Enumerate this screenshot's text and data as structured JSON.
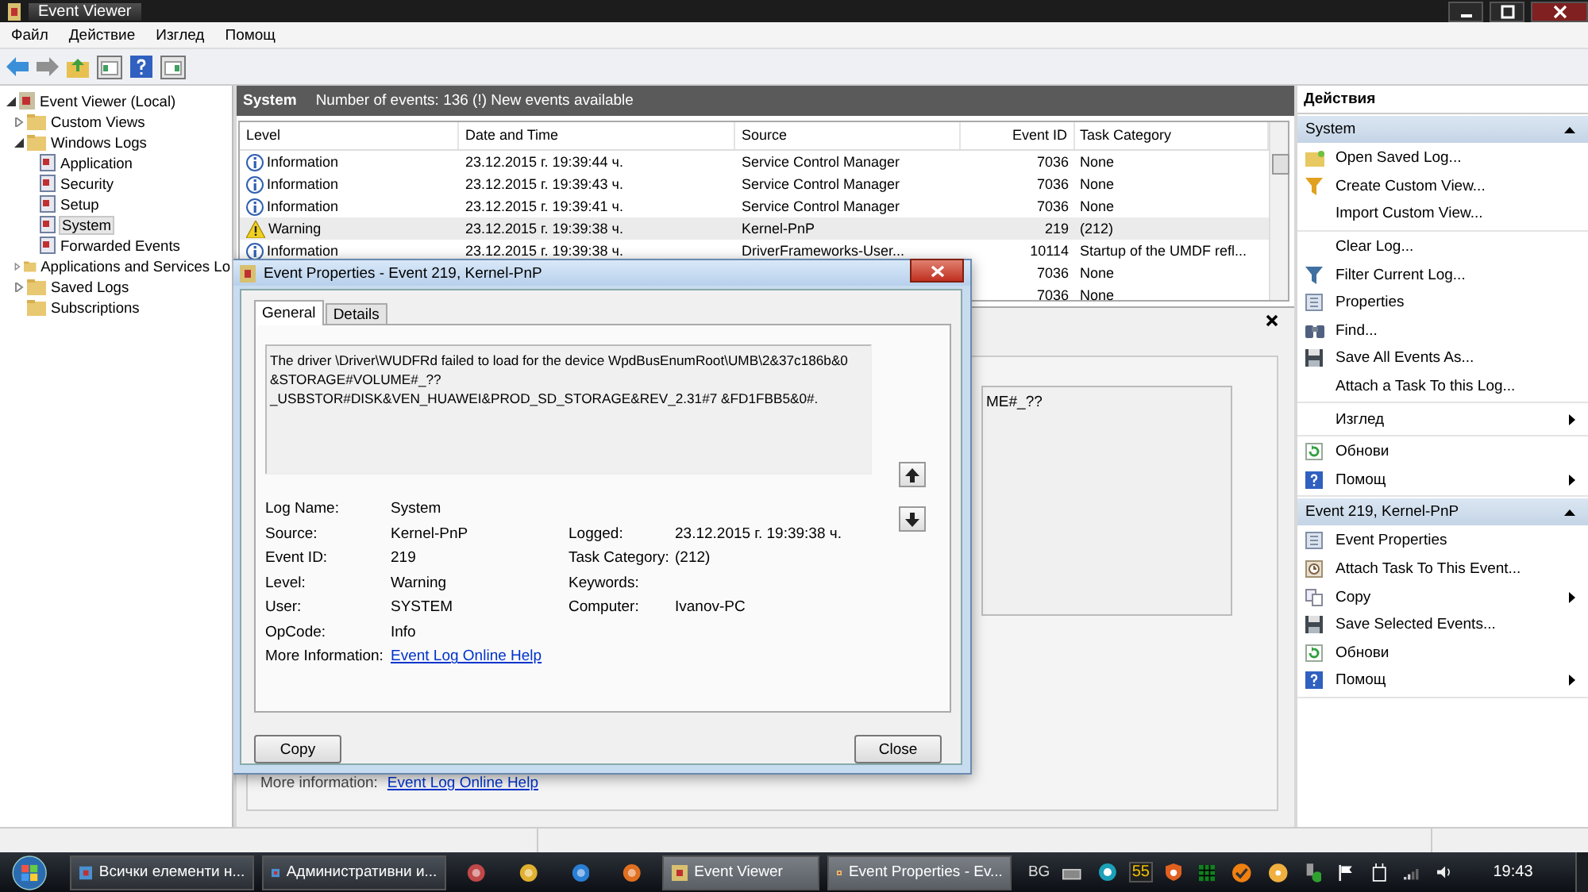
{
  "window": {
    "title": "Event Viewer"
  },
  "menu": [
    "Файл",
    "Действие",
    "Изглед",
    "Помощ"
  ],
  "tree": [
    {
      "label": "Event Viewer (Local)",
      "selected": false,
      "expanded": true,
      "children": [
        {
          "label": "Custom Views",
          "selected": false,
          "expanded": false
        },
        {
          "label": "Windows Logs",
          "selected": false,
          "expanded": true,
          "children": [
            {
              "label": "Application",
              "selected": false
            },
            {
              "label": "Security",
              "selected": false
            },
            {
              "label": "Setup",
              "selected": false
            },
            {
              "label": "System",
              "selected": true
            },
            {
              "label": "Forwarded Events",
              "selected": false
            }
          ]
        },
        {
          "label": "Applications and Services Lo",
          "selected": false,
          "expanded": false
        },
        {
          "label": "Saved Logs",
          "selected": false,
          "expanded": false
        },
        {
          "label": "Subscriptions",
          "selected": false
        }
      ]
    }
  ],
  "log_header": {
    "name": "System",
    "summary": "Number of events: 136 (!) New events available"
  },
  "table": {
    "columns": [
      "Level",
      "Date and Time",
      "Source",
      "Event ID",
      "Task Category"
    ],
    "rows": [
      {
        "kind": "info",
        "level": "Information",
        "date": "23.12.2015 г. 19:39:44 ч.",
        "source": "Service Control Manager",
        "event_id": "7036",
        "task_category": "None",
        "selected": false
      },
      {
        "kind": "info",
        "level": "Information",
        "date": "23.12.2015 г. 19:39:43 ч.",
        "source": "Service Control Manager",
        "event_id": "7036",
        "task_category": "None",
        "selected": false
      },
      {
        "kind": "info",
        "level": "Information",
        "date": "23.12.2015 г. 19:39:41 ч.",
        "source": "Service Control Manager",
        "event_id": "7036",
        "task_category": "None",
        "selected": false
      },
      {
        "kind": "warning",
        "level": "Warning",
        "date": "23.12.2015 г. 19:39:38 ч.",
        "source": "Kernel-PnP",
        "event_id": "219",
        "task_category": "(212)",
        "selected": true
      },
      {
        "kind": "info",
        "level": "Information",
        "date": "23.12.2015 г. 19:39:38 ч.",
        "source": "DriverFrameworks-User...",
        "event_id": "10114",
        "task_category": "Startup of the UMDF refl...",
        "selected": false
      },
      {
        "kind": "hidden",
        "event_id": "7036",
        "task_category": "None",
        "selected": false
      },
      {
        "kind": "hidden",
        "event_id": "7036",
        "task_category": "None",
        "selected": false
      }
    ]
  },
  "preview": {
    "message_fragment": "ME#_??",
    "more_info_label": "More information:",
    "more_info_link": "Event Log Online Help"
  },
  "dialog": {
    "title": "Event Properties - Event 219, Kernel-PnP",
    "tabs": [
      {
        "label": "General",
        "selected": true
      },
      {
        "label": "Details",
        "selected": false
      }
    ],
    "message": "The driver \\Driver\\WUDFRd failed to load for the device WpdBusEnumRoot\\UMB\\2&37c186b&0 &STORAGE#VOLUME#_??_USBSTOR#DISK&VEN_HUAWEI&PROD_SD_STORAGE&REV_2.31#7 &FD1FBB5&0#.",
    "fields_left": [
      {
        "label": "Log Name:",
        "value": "System"
      },
      {
        "label": "Source:",
        "value": "Kernel-PnP"
      },
      {
        "label": "Event ID:",
        "value": "219"
      },
      {
        "label": "Level:",
        "value": "Warning"
      },
      {
        "label": "User:",
        "value": "SYSTEM"
      },
      {
        "label": "OpCode:",
        "value": "Info"
      }
    ],
    "fields_right": [
      {
        "label": "Logged:",
        "value": "23.12.2015 г. 19:39:38 ч."
      },
      {
        "label": "Task Category:",
        "value": "(212)"
      },
      {
        "label": "Keywords:"
      },
      {
        "label": "Computer:",
        "value": "Ivanov-PC"
      }
    ],
    "more_info_label": "More Information:",
    "more_info_link": "Event Log Online Help",
    "buttons": [
      "Copy",
      "Close"
    ]
  },
  "actions": {
    "title": "Действия",
    "sections": [
      {
        "title": "System",
        "groups": [
          [
            {
              "label": "Open Saved Log...",
              "submenu": false
            },
            {
              "label": "Create Custom View...",
              "submenu": false
            },
            {
              "label": "Import Custom View...",
              "submenu": false
            }
          ],
          [
            {
              "label": "Clear Log...",
              "submenu": false
            },
            {
              "label": "Filter Current Log...",
              "submenu": false
            },
            {
              "label": "Properties",
              "submenu": false
            },
            {
              "label": "Find...",
              "submenu": false
            },
            {
              "label": "Save All Events As...",
              "submenu": false
            },
            {
              "label": "Attach a Task To this Log...",
              "submenu": false
            }
          ],
          [
            {
              "label": "Изглед",
              "submenu": true
            }
          ],
          [
            {
              "label": "Обнови",
              "submenu": false
            },
            {
              "label": "Помощ",
              "submenu": true
            }
          ]
        ]
      },
      {
        "title": "Event 219, Kernel-PnP",
        "groups": [
          [
            {
              "label": "Event Properties",
              "submenu": false
            },
            {
              "label": "Attach Task To This Event...",
              "submenu": false
            },
            {
              "label": "Copy",
              "submenu": true
            },
            {
              "label": "Save Selected Events...",
              "submenu": false
            },
            {
              "label": "Обнови",
              "submenu": false
            },
            {
              "label": "Помощ",
              "submenu": true
            }
          ]
        ]
      }
    ]
  },
  "taskbar": {
    "buttons": [
      {
        "label": "Всички елементи н...",
        "kind": "window"
      },
      {
        "label": "Административни и...",
        "kind": "window"
      },
      {
        "kind": "launch"
      },
      {
        "kind": "launch"
      },
      {
        "kind": "launch"
      },
      {
        "kind": "launch"
      },
      {
        "label": "Event Viewer",
        "kind": "window"
      },
      {
        "label": "Event Properties - Ev...",
        "kind": "window"
      }
    ],
    "language": "BG",
    "tray_badge": "55",
    "clock": "19:43"
  }
}
